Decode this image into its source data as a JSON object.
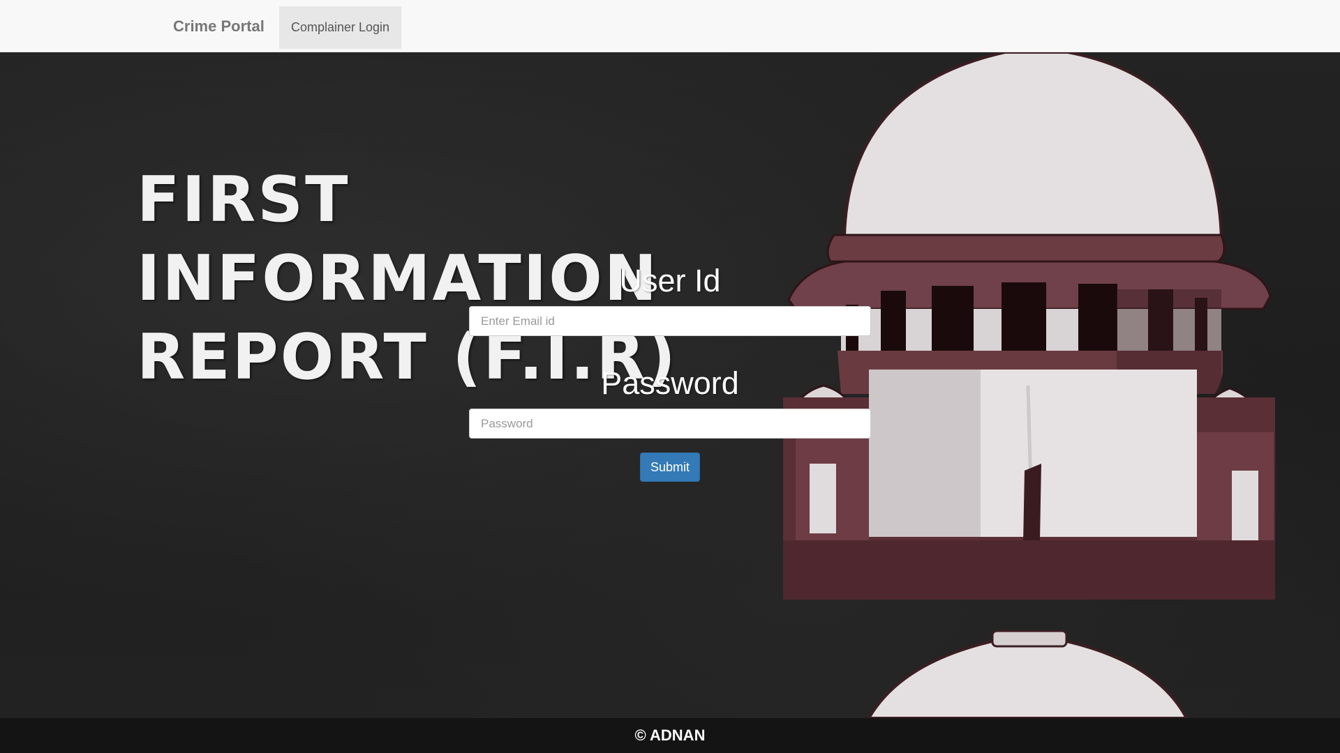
{
  "navbar": {
    "brand": "Crime Portal",
    "links": [
      {
        "label": "Complainer Login",
        "active": true
      }
    ]
  },
  "hero": {
    "heading_lines": [
      "FIRST",
      "INFORMATION",
      "REPORT (F.I.R)"
    ],
    "background_image": "supreme-court-building-illustration"
  },
  "login_form": {
    "user_id_label": "User Id",
    "user_id_placeholder": "Enter Email id",
    "user_id_value": "",
    "password_label": "Password",
    "password_placeholder": "Password",
    "password_value": "",
    "submit_label": "Submit"
  },
  "footer": {
    "text": "© ADNAN"
  },
  "colors": {
    "navbar_bg": "#f8f8f8",
    "primary_button": "#337ab7",
    "building_maroon": "#5a2f35",
    "page_bg": "#1d1d1d"
  }
}
